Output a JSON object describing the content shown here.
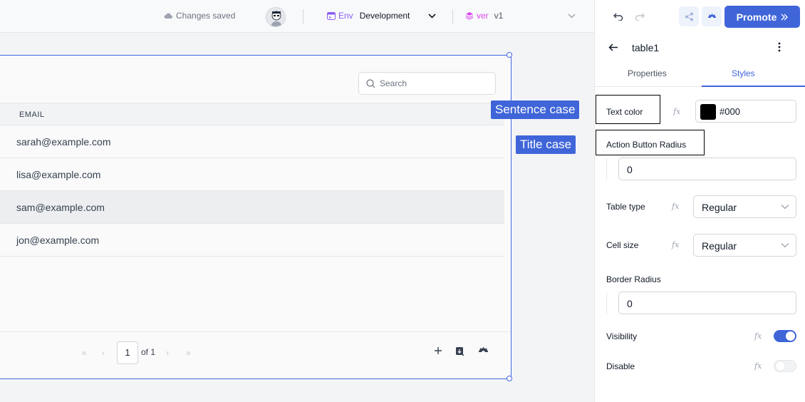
{
  "header": {
    "status_text": "Changes saved",
    "env_tag": "Env",
    "env_value": "Development",
    "version_tag": "ver",
    "version_value": "v1",
    "promote_label": "Promote"
  },
  "table": {
    "search_placeholder": "Search",
    "columns": [
      "EMAIL"
    ],
    "rows": [
      "sarah@example.com",
      "lisa@example.com",
      "sam@example.com",
      "jon@example.com"
    ],
    "selected_row": 2,
    "pagination": {
      "current_page": "1",
      "of_text": "of 1",
      "first": "«",
      "prev": "‹",
      "next": "›",
      "last": "»"
    }
  },
  "callouts": {
    "sentence_case": "Sentence case",
    "title_case": "Title case"
  },
  "panel": {
    "component_name": "table1",
    "tabs": [
      "Properties",
      "Styles"
    ],
    "active_tab": "Styles",
    "fx_label": "fx",
    "text_color": {
      "label": "Text color",
      "value": "#000"
    },
    "action_button_radius": {
      "label": "Action Button Radius",
      "value": "0"
    },
    "table_type": {
      "label": "Table type",
      "value": "Regular"
    },
    "cell_size": {
      "label": "Cell size",
      "value": "Regular"
    },
    "border_radius": {
      "label": "Border Radius",
      "value": "0"
    },
    "visibility": {
      "label": "Visibility",
      "on": true
    },
    "disable": {
      "label": "Disable",
      "on": false
    }
  },
  "colors": {
    "accent": "#3f65d9",
    "env_tag": "#8b5cf6",
    "version_tag": "#d946ef"
  }
}
